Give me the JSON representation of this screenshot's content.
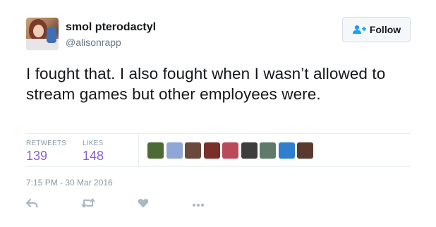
{
  "user": {
    "display_name": "smol pterodactyl",
    "handle": "@alisonrapp"
  },
  "follow_button": {
    "label": "Follow",
    "icon": "add-user-icon"
  },
  "tweet": {
    "text": "I fought that. I also fought when I wasn’t allowed to stream games but other employees were.",
    "timestamp": "7:15 PM - 30 Mar 2016"
  },
  "stats": {
    "retweets_label": "RETWEETS",
    "retweets_count": "139",
    "likes_label": "LIKES",
    "likes_count": "148"
  },
  "liker_avatars": [
    {
      "name": "liker-avatar-1",
      "color": "#4d6a35"
    },
    {
      "name": "liker-avatar-2",
      "color": "#8fa6d6"
    },
    {
      "name": "liker-avatar-3",
      "color": "#6b4a3e"
    },
    {
      "name": "liker-avatar-4",
      "color": "#7a2f2a"
    },
    {
      "name": "liker-avatar-5",
      "color": "#b94a5a"
    },
    {
      "name": "liker-avatar-6",
      "color": "#3d3d3d"
    },
    {
      "name": "liker-avatar-7",
      "color": "#5f7a6a"
    },
    {
      "name": "liker-avatar-8",
      "color": "#2f7fd0"
    },
    {
      "name": "liker-avatar-9",
      "color": "#5a3a2e"
    }
  ],
  "actions": [
    {
      "name": "reply-icon"
    },
    {
      "name": "retweet-icon"
    },
    {
      "name": "like-icon"
    },
    {
      "name": "more-icon"
    }
  ],
  "colors": {
    "stat_value": "#8a5fd1",
    "secondary_text": "#8899a6",
    "icon_gray": "#aab8c2"
  }
}
